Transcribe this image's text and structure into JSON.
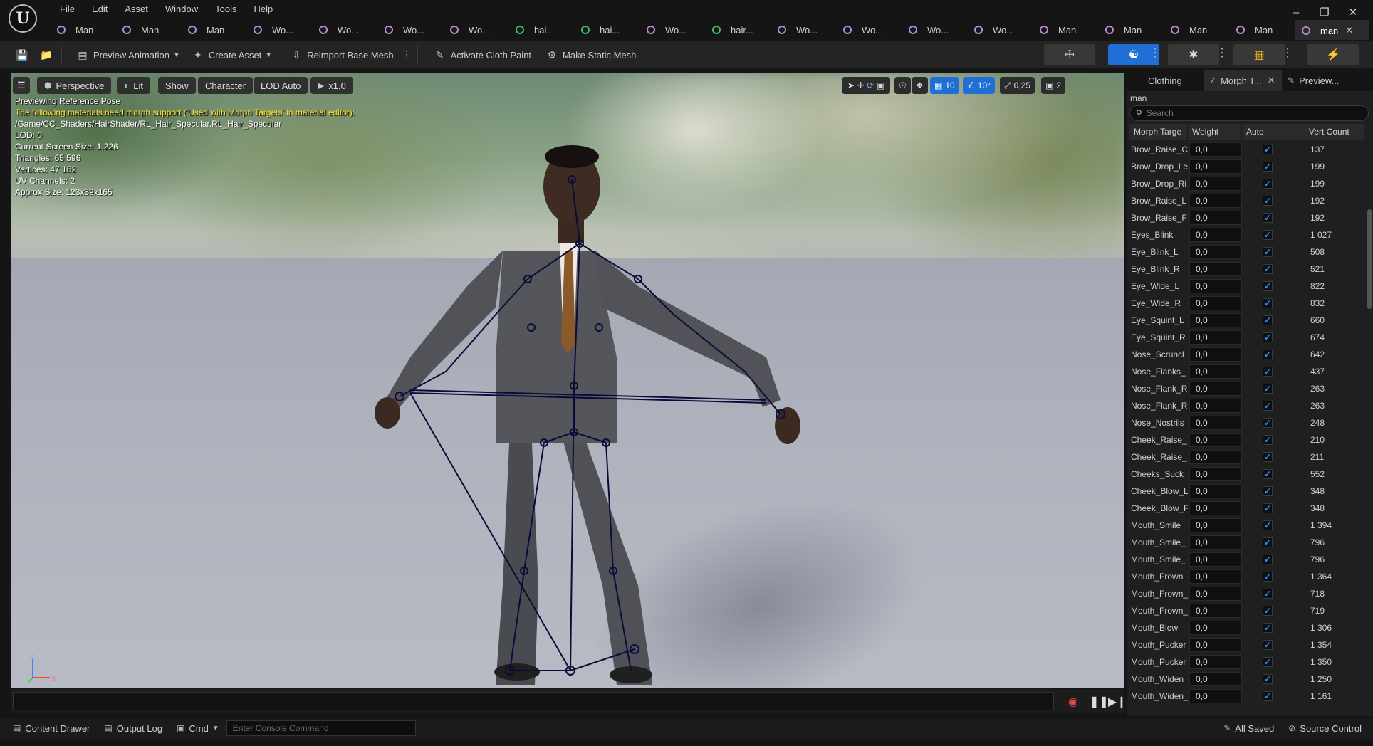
{
  "app": {
    "logo": "U",
    "menu": [
      "File",
      "Edit",
      "Asset",
      "Window",
      "Tools",
      "Help"
    ],
    "window_controls": [
      "–",
      "❐",
      "✕"
    ]
  },
  "tabs": [
    {
      "label": "Man",
      "icon": "skeletal-mesh-icon",
      "color": "purple"
    },
    {
      "label": "Man",
      "icon": "skeletal-mesh-icon",
      "color": "purple"
    },
    {
      "label": "Man",
      "icon": "skeletal-mesh-icon",
      "color": "purple"
    },
    {
      "label": "Wo...",
      "icon": "skeletal-mesh-icon",
      "color": "purple"
    },
    {
      "label": "Wo...",
      "icon": "skeletal-mesh-icon",
      "color": "purple"
    },
    {
      "label": "Wo...",
      "icon": "skeletal-mesh-icon",
      "color": "purple"
    },
    {
      "label": "Wo...",
      "icon": "skeletal-mesh-icon",
      "color": "purple"
    },
    {
      "label": "hai...",
      "icon": "groom-icon",
      "color": "green"
    },
    {
      "label": "hai...",
      "icon": "groom-icon",
      "color": "green"
    },
    {
      "label": "Wo...",
      "icon": "skeletal-mesh-icon",
      "color": "purple"
    },
    {
      "label": "hair...",
      "icon": "groom-icon",
      "color": "green"
    },
    {
      "label": "Wo...",
      "icon": "skeletal-mesh-icon",
      "color": "purple"
    },
    {
      "label": "Wo...",
      "icon": "skeletal-mesh-icon",
      "color": "purple"
    },
    {
      "label": "Wo...",
      "icon": "skeletal-mesh-icon",
      "color": "purple"
    },
    {
      "label": "Wo...",
      "icon": "skeletal-mesh-icon",
      "color": "purple"
    },
    {
      "label": "Man",
      "icon": "skeletal-mesh-icon",
      "color": "purple"
    },
    {
      "label": "Man",
      "icon": "skeletal-mesh-icon",
      "color": "purple"
    },
    {
      "label": "Man",
      "icon": "skeletal-mesh-icon",
      "color": "purple"
    },
    {
      "label": "Man",
      "icon": "skeletal-mesh-icon",
      "color": "purple"
    },
    {
      "label": "man",
      "icon": "skeletal-mesh-icon",
      "color": "purple",
      "active": true
    }
  ],
  "toolbar": {
    "preview_animation": "Preview Animation",
    "create_asset": "Create Asset",
    "reimport_base_mesh": "Reimport Base Mesh",
    "activate_cloth_paint": "Activate Cloth Paint",
    "make_static_mesh": "Make Static Mesh"
  },
  "viewport": {
    "perspective": "Perspective",
    "lit": "Lit",
    "show": "Show",
    "character": "Character",
    "lod": "LOD Auto",
    "play_rate": "x1,0",
    "grid_snap": "10",
    "rotation_snap": "10°",
    "scale_snap": "0,25",
    "camera_speed": "2",
    "info": {
      "line1": "Previewing Reference Pose",
      "warning": "The following materials need morph support ('Used with Morph Targets' in material editor):",
      "material_path": "/Game/CC_Shaders/HairShader/RL_Hair_Specular.RL_Hair_Specular",
      "lod": "LOD: 0",
      "screen_size": "Current Screen Size: 1,226",
      "triangles": "Triangles: 65 596",
      "vertices": "Vertices: 47 162",
      "uv_channels": "UV Channels: 2",
      "approx_size": "Approx Size: 123x39x165"
    },
    "axis_z": "Z",
    "axis_x": "X"
  },
  "statusbar": {
    "content_drawer": "Content Drawer",
    "output_log": "Output Log",
    "cmd": "Cmd",
    "console_placeholder": "Enter Console Command",
    "all_saved": "All Saved",
    "source_control": "Source Control"
  },
  "panel": {
    "tabs": [
      "Clothing",
      "Morph T...",
      "Preview..."
    ],
    "asset_name": "man",
    "search_placeholder": "Search",
    "columns": [
      "Morph Targe",
      "Weight",
      "Auto",
      "Vert Count"
    ],
    "rows": [
      {
        "name": "Brow_Raise_C",
        "weight": "0,0",
        "auto": true,
        "verts": "137"
      },
      {
        "name": "Brow_Drop_Le",
        "weight": "0,0",
        "auto": true,
        "verts": "199"
      },
      {
        "name": "Brow_Drop_Ri",
        "weight": "0,0",
        "auto": true,
        "verts": "199"
      },
      {
        "name": "Brow_Raise_L",
        "weight": "0,0",
        "auto": true,
        "verts": "192"
      },
      {
        "name": "Brow_Raise_F",
        "weight": "0,0",
        "auto": true,
        "verts": "192"
      },
      {
        "name": "Eyes_Blink",
        "weight": "0,0",
        "auto": true,
        "verts": "1 027"
      },
      {
        "name": "Eye_Blink_L",
        "weight": "0,0",
        "auto": true,
        "verts": "508"
      },
      {
        "name": "Eye_Blink_R",
        "weight": "0,0",
        "auto": true,
        "verts": "521"
      },
      {
        "name": "Eye_Wide_L",
        "weight": "0,0",
        "auto": true,
        "verts": "822"
      },
      {
        "name": "Eye_Wide_R",
        "weight": "0,0",
        "auto": true,
        "verts": "832"
      },
      {
        "name": "Eye_Squint_L",
        "weight": "0,0",
        "auto": true,
        "verts": "660"
      },
      {
        "name": "Eye_Squint_R",
        "weight": "0,0",
        "auto": true,
        "verts": "674"
      },
      {
        "name": "Nose_Scruncl",
        "weight": "0,0",
        "auto": true,
        "verts": "642"
      },
      {
        "name": "Nose_Flanks_",
        "weight": "0,0",
        "auto": true,
        "verts": "437"
      },
      {
        "name": "Nose_Flank_R",
        "weight": "0,0",
        "auto": true,
        "verts": "263"
      },
      {
        "name": "Nose_Flank_R",
        "weight": "0,0",
        "auto": true,
        "verts": "263"
      },
      {
        "name": "Nose_Nostrils",
        "weight": "0,0",
        "auto": true,
        "verts": "248"
      },
      {
        "name": "Cheek_Raise_",
        "weight": "0,0",
        "auto": true,
        "verts": "210"
      },
      {
        "name": "Cheek_Raise_",
        "weight": "0,0",
        "auto": true,
        "verts": "211"
      },
      {
        "name": "Cheeks_Suck",
        "weight": "0,0",
        "auto": true,
        "verts": "552"
      },
      {
        "name": "Cheek_Blow_L",
        "weight": "0,0",
        "auto": true,
        "verts": "348"
      },
      {
        "name": "Cheek_Blow_F",
        "weight": "0,0",
        "auto": true,
        "verts": "348"
      },
      {
        "name": "Mouth_Smile",
        "weight": "0,0",
        "auto": true,
        "verts": "1 394"
      },
      {
        "name": "Mouth_Smile_",
        "weight": "0,0",
        "auto": true,
        "verts": "796"
      },
      {
        "name": "Mouth_Smile_",
        "weight": "0,0",
        "auto": true,
        "verts": "796"
      },
      {
        "name": "Mouth_Frown",
        "weight": "0,0",
        "auto": true,
        "verts": "1 364"
      },
      {
        "name": "Mouth_Frown_",
        "weight": "0,0",
        "auto": true,
        "verts": "718"
      },
      {
        "name": "Mouth_Frown_",
        "weight": "0,0",
        "auto": true,
        "verts": "719"
      },
      {
        "name": "Mouth_Blow",
        "weight": "0,0",
        "auto": true,
        "verts": "1 306"
      },
      {
        "name": "Mouth_Pucker",
        "weight": "0,0",
        "auto": true,
        "verts": "1 354"
      },
      {
        "name": "Mouth_Pucker",
        "weight": "0,0",
        "auto": true,
        "verts": "1 350"
      },
      {
        "name": "Mouth_Widen",
        "weight": "0,0",
        "auto": true,
        "verts": "1 250"
      },
      {
        "name": "Mouth_Widen_",
        "weight": "0,0",
        "auto": true,
        "verts": "1 161"
      }
    ]
  },
  "colors": {
    "accent": "#1f6fd6",
    "warning_text": "#ffe02a",
    "skeleton": "#0b0b3a"
  }
}
